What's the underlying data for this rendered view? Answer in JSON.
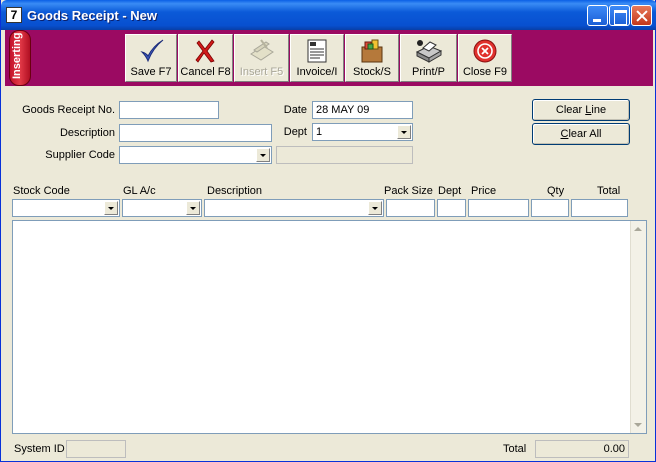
{
  "window": {
    "icon_text": "7",
    "title": "Goods Receipt - New"
  },
  "status_tab": {
    "label": "Inserting"
  },
  "toolbar": {
    "buttons": [
      {
        "label": "Save F7",
        "icon": "checkmark-icon",
        "enabled": true
      },
      {
        "label": "Cancel F8",
        "icon": "red-x-icon",
        "enabled": true
      },
      {
        "label": "Insert F5",
        "icon": "insert-rows-icon",
        "enabled": false
      },
      {
        "label": "Invoice/I",
        "icon": "invoice-document-icon",
        "enabled": true
      },
      {
        "label": "Stock/S",
        "icon": "stock-boxes-icon",
        "enabled": true
      },
      {
        "label": "Print/P",
        "icon": "printer-icon",
        "enabled": true
      },
      {
        "label": "Close F9",
        "icon": "close-circle-icon",
        "enabled": true
      }
    ]
  },
  "header": {
    "receipt_no_label": "Goods Receipt No.",
    "receipt_no_value": "",
    "description_label": "Description",
    "description_value": "",
    "supplier_label": "Supplier Code",
    "supplier_value": "",
    "supplier_name_value": "",
    "date_label": "Date",
    "date_value": "28 MAY 09",
    "dept_label": "Dept",
    "dept_value": "1"
  },
  "actions": {
    "clear_line_prefix": "Clear ",
    "clear_line_accel": "L",
    "clear_line_suffix": "ine",
    "clear_all_accel": "C",
    "clear_all_suffix": "lear All"
  },
  "lines": {
    "columns": {
      "stock_code": "Stock Code",
      "gl_ac": "GL A/c",
      "description": "Description",
      "pack_size": "Pack Size",
      "dept": "Dept",
      "price": "Price",
      "qty": "Qty",
      "total": "Total"
    },
    "entry": {
      "stock_code": "",
      "gl_ac": "",
      "description": "",
      "pack_size": "",
      "dept": "",
      "price": "",
      "qty": "",
      "total": ""
    },
    "rows": []
  },
  "footer": {
    "system_id_label": "System ID",
    "system_id_value": "",
    "total_label": "Total",
    "total_value": "0.00"
  },
  "colors": {
    "toolbar_bg": "#9b0a62",
    "title_bar": "#0b5ad8",
    "status_tab": "#d1192e"
  }
}
